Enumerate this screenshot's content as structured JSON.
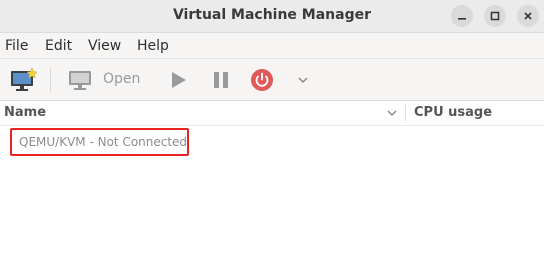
{
  "window": {
    "title": "Virtual Machine Manager",
    "controls": [
      "minimize",
      "maximize",
      "close"
    ]
  },
  "menu": {
    "items": [
      "File",
      "Edit",
      "View",
      "Help"
    ]
  },
  "toolbar": {
    "new_vm_icon": "monitor-with-star-icon",
    "open_icon": "monitor-icon",
    "open_label": "Open",
    "run_icon": "play-icon",
    "pause_icon": "pause-icon",
    "shutdown_icon": "power-icon",
    "shutdown_color": "#e05a5a",
    "menu_icon": "chevron-down-icon"
  },
  "columns": {
    "name": "Name",
    "cpu": "CPU usage"
  },
  "connections": [
    {
      "label": "QEMU/KVM - Not Connected",
      "highlight_color": "#e8231f"
    }
  ]
}
